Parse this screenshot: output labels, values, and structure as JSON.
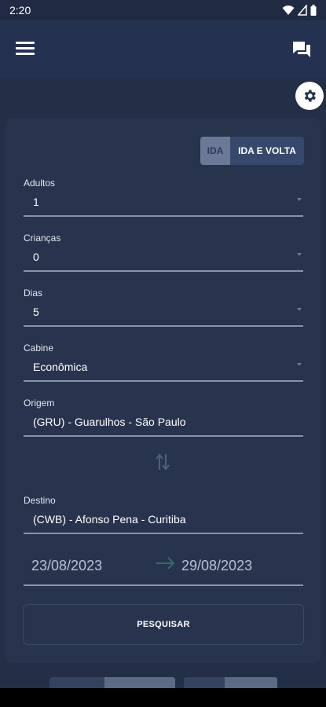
{
  "status_bar": {
    "time": "2:20"
  },
  "app_bar": {
    "menu_icon": "hamburger-menu-icon",
    "chat_icon": "chat-bubbles-icon"
  },
  "settings": {
    "icon": "gear-icon"
  },
  "trip_type": {
    "one_way": "IDA",
    "round_trip": "IDA E VOLTA",
    "selected": "IDA"
  },
  "fields": {
    "adults": {
      "label": "Adultos",
      "value": "1"
    },
    "children": {
      "label": "Crianças",
      "value": "0"
    },
    "days": {
      "label": "Dias",
      "value": "5"
    },
    "cabin": {
      "label": "Cabine",
      "value": "Econômica"
    },
    "origin": {
      "label": "Origem",
      "value": "(GRU) - Guarulhos - São Paulo"
    },
    "destination": {
      "label": "Destino",
      "value": "(CWB) - Afonso Pena - Curitiba"
    }
  },
  "dates": {
    "start": "23/08/2023",
    "end": "29/08/2023"
  },
  "search_button": {
    "label": "PESQUISAR"
  },
  "colors": {
    "background": "#232e47",
    "card": "#28344e",
    "app_bar": "#253150",
    "line": "#8893a8",
    "toggle_selected": "#6b7997",
    "toggle_unselected": "#36486b"
  }
}
